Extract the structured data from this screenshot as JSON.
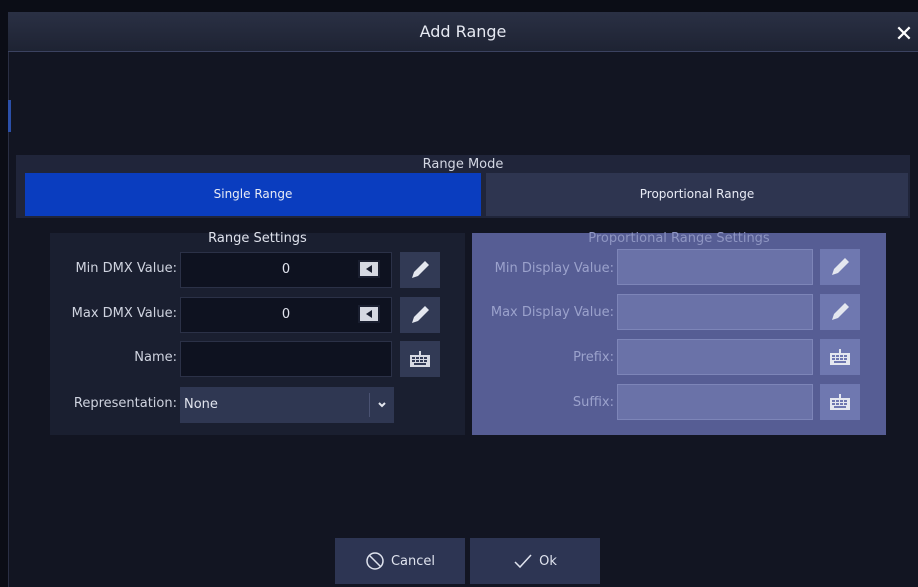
{
  "dialog": {
    "title": "Add Range",
    "close_glyph": "✕"
  },
  "range_mode": {
    "label": "Range Mode",
    "options": [
      {
        "label": "Single Range",
        "selected": true
      },
      {
        "label": "Proportional Range",
        "selected": false
      }
    ]
  },
  "range_settings": {
    "title": "Range Settings",
    "min_dmx": {
      "label": "Min DMX Value:",
      "value": "0"
    },
    "max_dmx": {
      "label": "Max DMX Value:",
      "value": "0"
    },
    "name": {
      "label": "Name:",
      "value": ""
    },
    "representation": {
      "label": "Representation:",
      "value": "None"
    }
  },
  "proportional_settings": {
    "title": "Proportional Range Settings",
    "min_display": {
      "label": "Min Display Value:",
      "value": ""
    },
    "max_display": {
      "label": "Max Display Value:",
      "value": ""
    },
    "prefix": {
      "label": "Prefix:",
      "value": ""
    },
    "suffix": {
      "label": "Suffix:",
      "value": ""
    }
  },
  "footer": {
    "cancel_label": "Cancel",
    "ok_label": "Ok"
  },
  "colors": {
    "accent": "#0a3dbf",
    "dialog_bg": "#121522",
    "disabled_panel": "#565d94"
  },
  "icons": [
    "close-icon",
    "pencil-icon",
    "keyboard-icon",
    "backspace-icon",
    "chevron-down-icon",
    "cancel-icon",
    "check-icon"
  ]
}
